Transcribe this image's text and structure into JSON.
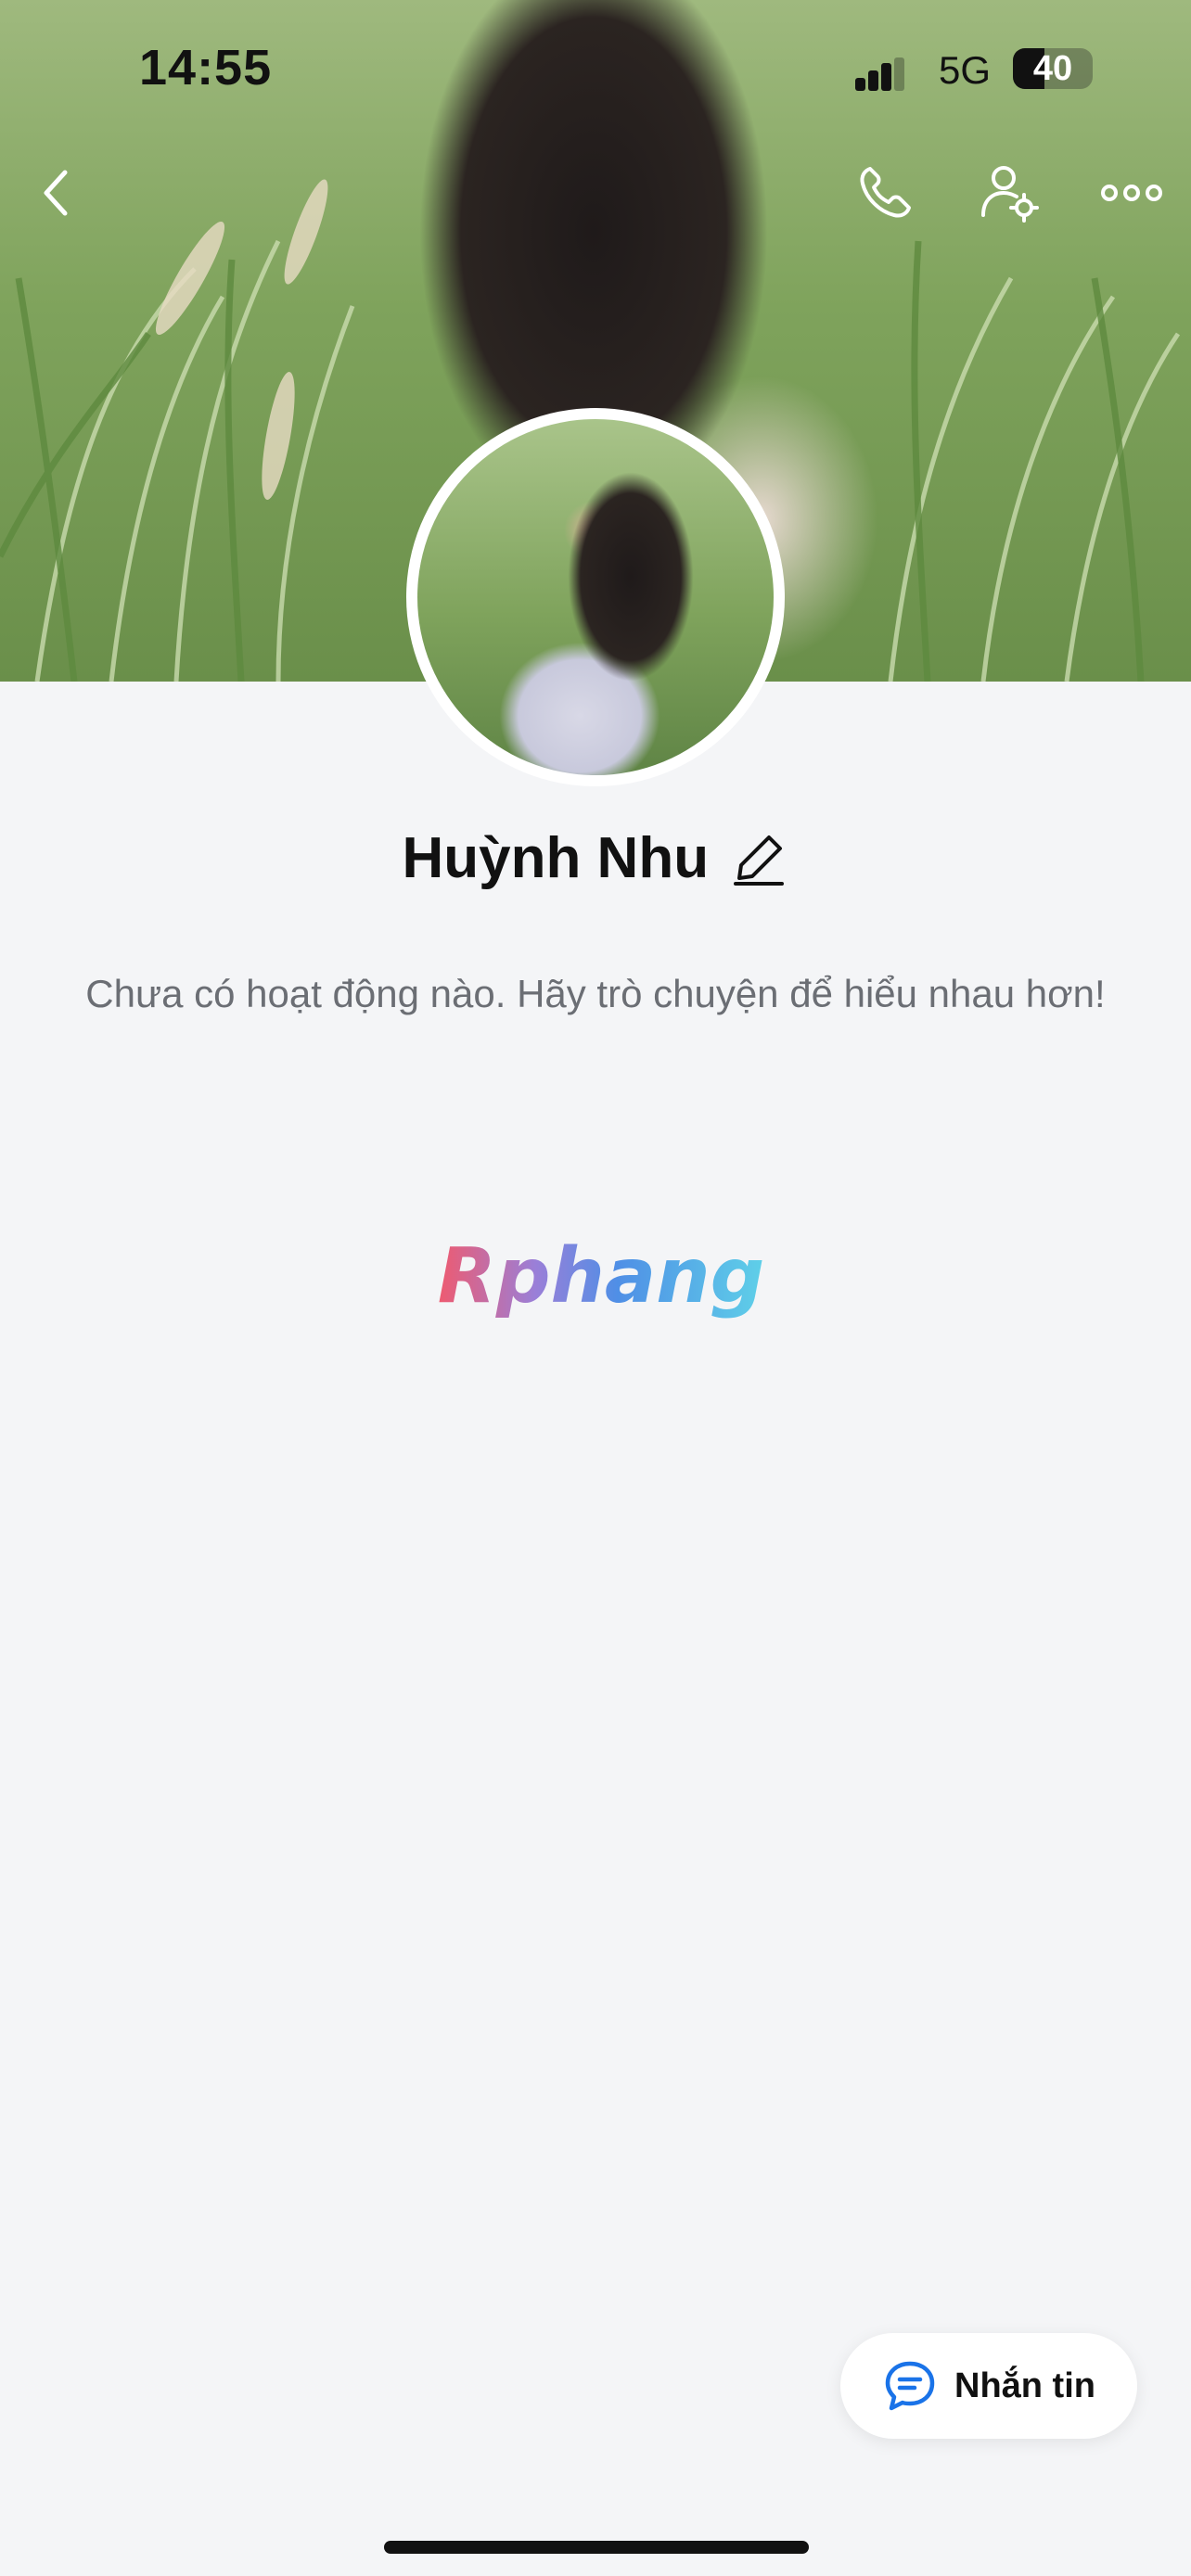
{
  "status_bar": {
    "time": "14:55",
    "network": "5G",
    "battery": "40",
    "battery_level": 0.4
  },
  "header": {
    "back_icon": "chevron-left-icon",
    "call_icon": "phone-icon",
    "settings_icon": "user-settings-icon",
    "more_icon": "more-horizontal-icon"
  },
  "profile": {
    "name": "Huỳnh Nhu",
    "edit_icon": "pencil-icon",
    "activity_empty_text": "Chưa có hoạt động nào. Hãy trò chuyện để hiểu nhau hơn!"
  },
  "watermark": {
    "text": "Rphang"
  },
  "message_button": {
    "label": "Nhắn tin",
    "icon": "chat-bubble-icon"
  },
  "colors": {
    "accent": "#1a73e8",
    "background": "#f4f5f7",
    "text_primary": "#111111",
    "text_secondary": "#6b6e74"
  }
}
